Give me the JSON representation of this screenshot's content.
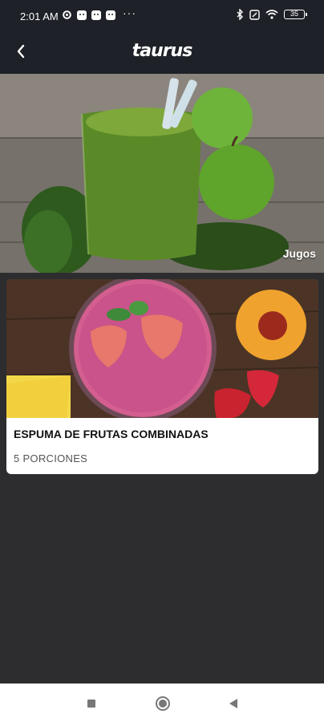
{
  "status_bar": {
    "time": "2:01 AM",
    "battery": "35",
    "icons": [
      "settings-icon",
      "discord-icon",
      "discord-icon",
      "discord-icon",
      "more-dots",
      "bluetooth-icon",
      "sim-icon",
      "wifi-icon",
      "battery-icon"
    ]
  },
  "header": {
    "brand": "taurus",
    "back_icon": "chevron-left-icon"
  },
  "hero": {
    "category": "Jugos"
  },
  "recipes": [
    {
      "title": "ESPUMA DE FRUTAS COMBINADAS",
      "servings": "5 PORCIONES"
    }
  ],
  "nav": {
    "icons": [
      "recent-apps-icon",
      "home-icon",
      "back-icon"
    ]
  },
  "colors": {
    "header_bg": "#1e2127",
    "page_bg": "#2d2d2f",
    "card_bg": "#ffffff"
  }
}
